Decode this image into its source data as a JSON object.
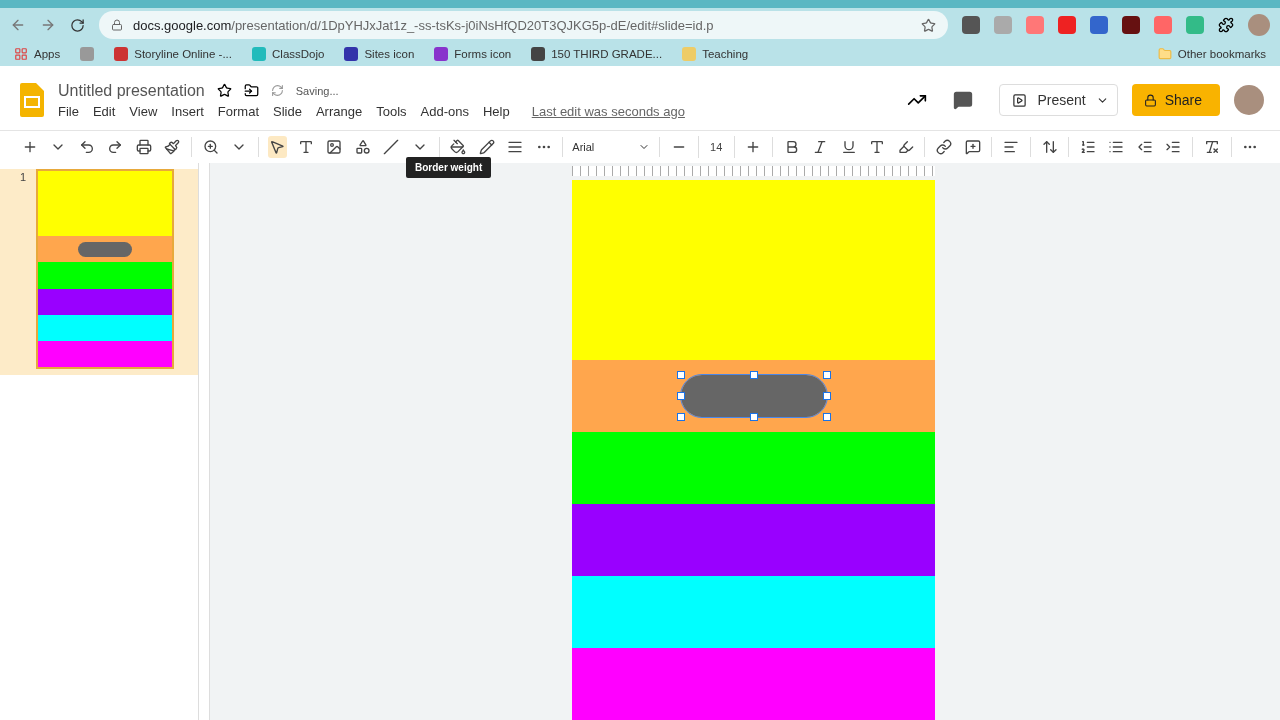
{
  "browser": {
    "url_host": "docs.google.com",
    "url_path": "/presentation/d/1DpYHJxJat1z_-ss-tsKs-j0iNsHfQD20T3QJKG5p-dE/edit#slide=id.p",
    "bookmarks": [
      {
        "kind": "apps",
        "label": "Apps"
      },
      {
        "kind": "icon_only"
      },
      {
        "kind": "site",
        "label": "Storyline Online -..."
      },
      {
        "kind": "site",
        "label": "ClassDojo"
      },
      {
        "kind": "site",
        "label": "Sites icon"
      },
      {
        "kind": "site",
        "label": "Forms icon"
      },
      {
        "kind": "site",
        "label": "150 THIRD GRADE..."
      },
      {
        "kind": "site",
        "label": "Teaching"
      }
    ],
    "other_bookmarks": "Other bookmarks"
  },
  "header": {
    "title": "Untitled presentation",
    "status": "Saving...",
    "menu": [
      "File",
      "Edit",
      "View",
      "Insert",
      "Format",
      "Slide",
      "Arrange",
      "Tools",
      "Add-ons",
      "Help"
    ],
    "last_edit": "Last edit was seconds ago",
    "present": "Present",
    "share": "Share"
  },
  "toolbar": {
    "font": "Arial",
    "font_size": "14",
    "tooltip": "Border weight"
  },
  "filmstrip": [
    {
      "number": "1",
      "selected": true
    }
  ],
  "slide": {
    "bands": [
      {
        "color": "#ffff00"
      },
      {
        "color": "#ffa64d",
        "shape": {
          "selected": true
        }
      },
      {
        "color": "#00ff00"
      },
      {
        "color": "#9900ff"
      },
      {
        "color": "#00ffff"
      },
      {
        "color": "#ff00ff"
      }
    ]
  }
}
